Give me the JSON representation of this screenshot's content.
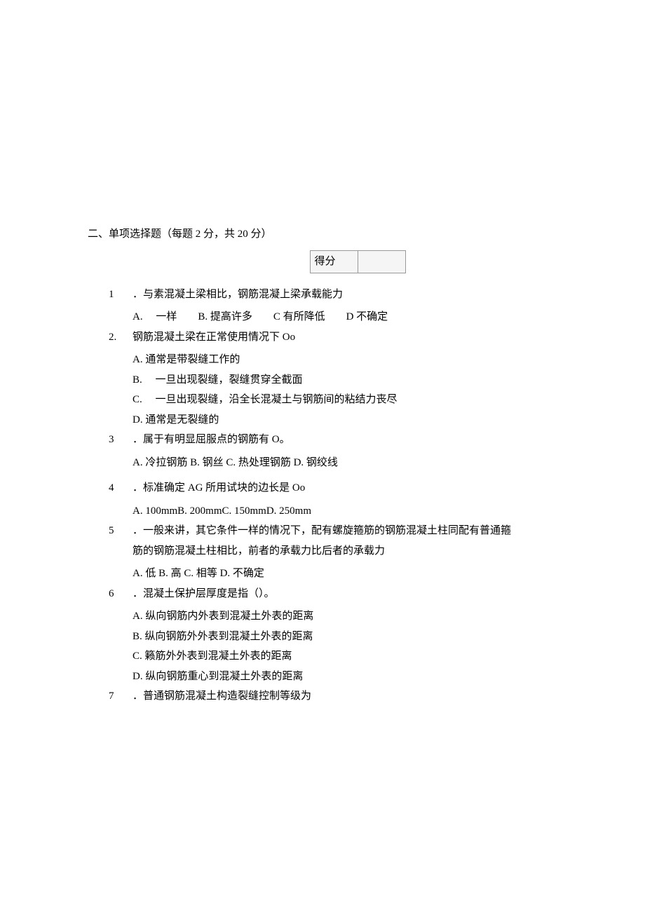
{
  "section": {
    "title": "二、单项选择题（每题 2 分，共 20 分）",
    "score_label": "得分"
  },
  "questions": [
    {
      "num": "1",
      "stem": "．与素混凝土梁相比，钢筋混凝上梁承载能力",
      "options_line": "A.　 一样　　B. 提高许多　　C 有所降低　　D 不确定"
    },
    {
      "num": "2.",
      "stem": "钢筋混凝土梁在正常使用情况下 Oo",
      "options": [
        "A. 通常是带裂缝工作的",
        "B.　 一旦出现裂缝，裂缝贯穿全截面",
        "C.　 一旦出现裂缝，沿全长混凝土与钢筋间的粘结力丧尽",
        "D. 通常是无裂缝的"
      ]
    },
    {
      "num": "3",
      "stem": "．属于有明显屈服点的钢筋有 O。",
      "options_line": "A. 冷拉钢筋 B. 钢丝 C. 热处理钢筋 D. 钢绞线"
    },
    {
      "num": "4",
      "stem": "．标准确定 AG 所用试块的边长是 Oo",
      "options_line": "A. 100mmB. 200mmC. 150mmD. 250mm"
    },
    {
      "num": "5",
      "stem": "．一般来讲，其它条件一样的情况下，配有螺旋箍筋的钢筋混凝土柱同配有普通箍",
      "stem_cont": "筋的钢筋混凝土柱相比，前者的承载力比后者的承载力",
      "options_line": "A. 低 B. 高 C. 相等 D. 不确定"
    },
    {
      "num": "6",
      "stem": "．混凝土保护层厚度是指（）。",
      "options": [
        "A. 纵向钢筋内外表到混凝土外表的距离",
        "B. 纵向钢筋外外表到混凝土外表的距离",
        "C. 籁筋外外表到混凝土外表的距离",
        "D. 纵向钢筋重心到混凝土外表的距离"
      ]
    },
    {
      "num": "7",
      "stem": "．普通钢筋混凝土构造裂缝控制等级为"
    }
  ]
}
